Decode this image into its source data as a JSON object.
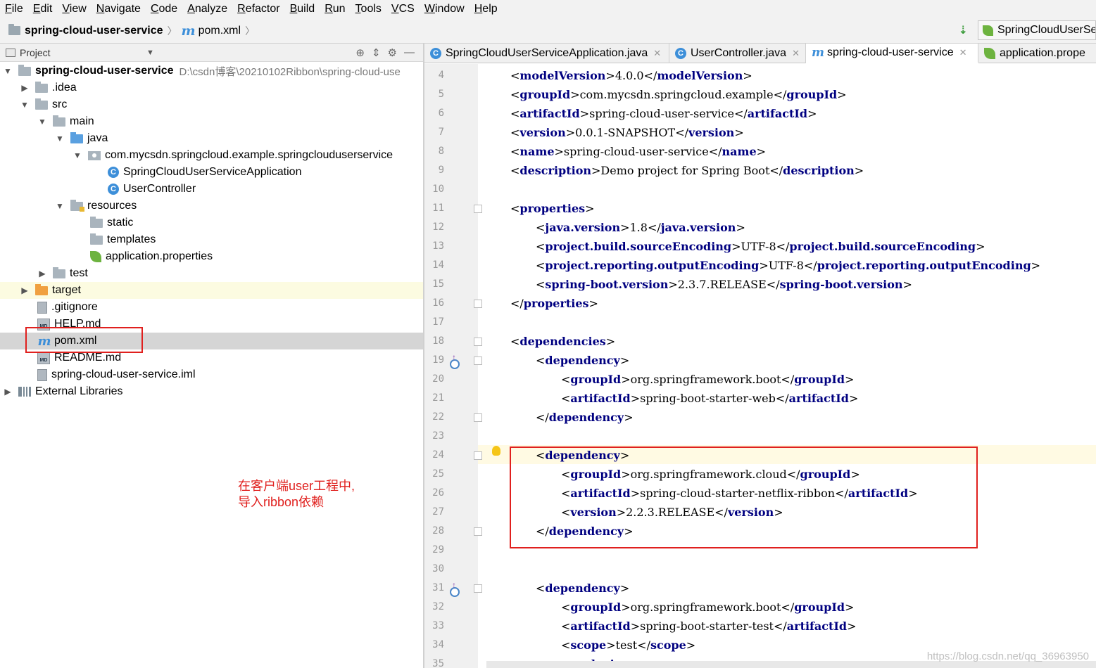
{
  "menu": [
    "File",
    "Edit",
    "View",
    "Navigate",
    "Code",
    "Analyze",
    "Refactor",
    "Build",
    "Run",
    "Tools",
    "VCS",
    "Window",
    "Help"
  ],
  "breadcrumb": {
    "project": "spring-cloud-user-service",
    "file": "pom.xml"
  },
  "run_config": "SpringCloudUserSe",
  "project_panel": {
    "title": "Project"
  },
  "tree": [
    {
      "label": "spring-cloud-user-service",
      "path": "D:\\csdn博客\\20210102Ribbon\\spring-cloud-use"
    },
    {
      "label": ".idea"
    },
    {
      "label": "src"
    },
    {
      "label": "main"
    },
    {
      "label": "java"
    },
    {
      "label": "com.mycsdn.springcloud.example.springclouduserservice"
    },
    {
      "label": "SpringCloudUserServiceApplication"
    },
    {
      "label": "UserController"
    },
    {
      "label": "resources"
    },
    {
      "label": "static"
    },
    {
      "label": "templates"
    },
    {
      "label": "application.properties"
    },
    {
      "label": "test"
    },
    {
      "label": "target"
    },
    {
      "label": ".gitignore"
    },
    {
      "label": "HELP.md"
    },
    {
      "label": "pom.xml"
    },
    {
      "label": "README.md"
    },
    {
      "label": "spring-cloud-user-service.iml"
    },
    {
      "label": "External Libraries"
    }
  ],
  "annotation": {
    "line1": "在客户端user工程中,",
    "line2": "导入ribbon依赖"
  },
  "tabs": [
    {
      "label": "SpringCloudUserServiceApplication.java"
    },
    {
      "label": "UserController.java"
    },
    {
      "label": "spring-cloud-user-service"
    },
    {
      "label": "application.prope"
    }
  ],
  "line_numbers": [
    "4",
    "5",
    "6",
    "7",
    "8",
    "9",
    "10",
    "11",
    "12",
    "13",
    "14",
    "15",
    "16",
    "17",
    "18",
    "19",
    "20",
    "21",
    "22",
    "23",
    "24",
    "25",
    "26",
    "27",
    "28",
    "29",
    "30",
    "31",
    "32",
    "33",
    "34",
    "35"
  ],
  "code": [
    {
      "indent": 0,
      "tag": "modelVersion",
      "text": "4.0.0"
    },
    {
      "indent": 0,
      "tag": "groupId",
      "text": "com.mycsdn.springcloud.example"
    },
    {
      "indent": 0,
      "tag": "artifactId",
      "text": "spring-cloud-user-service"
    },
    {
      "indent": 0,
      "tag": "version",
      "text": "0.0.1-SNAPSHOT"
    },
    {
      "indent": 0,
      "tag": "name",
      "text": "spring-cloud-user-service"
    },
    {
      "indent": 0,
      "tag": "description",
      "text": "Demo project for Spring Boot"
    },
    {
      "indent": 0,
      "tag": "",
      "text": ""
    },
    {
      "indent": 0,
      "open": "properties"
    },
    {
      "indent": 1,
      "tag": "java.version",
      "text": "1.8"
    },
    {
      "indent": 1,
      "tag": "project.build.sourceEncoding",
      "text": "UTF-8"
    },
    {
      "indent": 1,
      "tag": "project.reporting.outputEncoding",
      "text": "UTF-8"
    },
    {
      "indent": 1,
      "tag": "spring-boot.version",
      "text": "2.3.7.RELEASE"
    },
    {
      "indent": 0,
      "close": "properties"
    },
    {
      "indent": 0,
      "tag": "",
      "text": ""
    },
    {
      "indent": 0,
      "open": "dependencies"
    },
    {
      "indent": 1,
      "open": "dependency"
    },
    {
      "indent": 2,
      "tag": "groupId",
      "text": "org.springframework.boot"
    },
    {
      "indent": 2,
      "tag": "artifactId",
      "text": "spring-boot-starter-web"
    },
    {
      "indent": 1,
      "close": "dependency"
    },
    {
      "indent": 0,
      "tag": "",
      "text": ""
    },
    {
      "indent": 1,
      "open": "dependency"
    },
    {
      "indent": 2,
      "tag": "groupId",
      "text": "org.springframework.cloud"
    },
    {
      "indent": 2,
      "tag": "artifactId",
      "text": "spring-cloud-starter-netflix-ribbon"
    },
    {
      "indent": 2,
      "tag": "version",
      "text": "2.2.3.RELEASE"
    },
    {
      "indent": 1,
      "close": "dependency"
    },
    {
      "indent": 0,
      "tag": "",
      "text": ""
    },
    {
      "indent": 0,
      "tag": "",
      "text": ""
    },
    {
      "indent": 1,
      "open": "dependency"
    },
    {
      "indent": 2,
      "tag": "groupId",
      "text": "org.springframework.boot"
    },
    {
      "indent": 2,
      "tag": "artifactId",
      "text": "spring-boot-starter-test"
    },
    {
      "indent": 2,
      "tag": "scope",
      "text": "test"
    },
    {
      "indent": 2,
      "open": "exclusions"
    }
  ],
  "watermark": "https://blog.csdn.net/qq_36963950",
  "colors": {
    "tag": "#000080",
    "annotation": "#e0201e",
    "selection": "#d5d5d5",
    "accent": "#3d8fd9"
  }
}
